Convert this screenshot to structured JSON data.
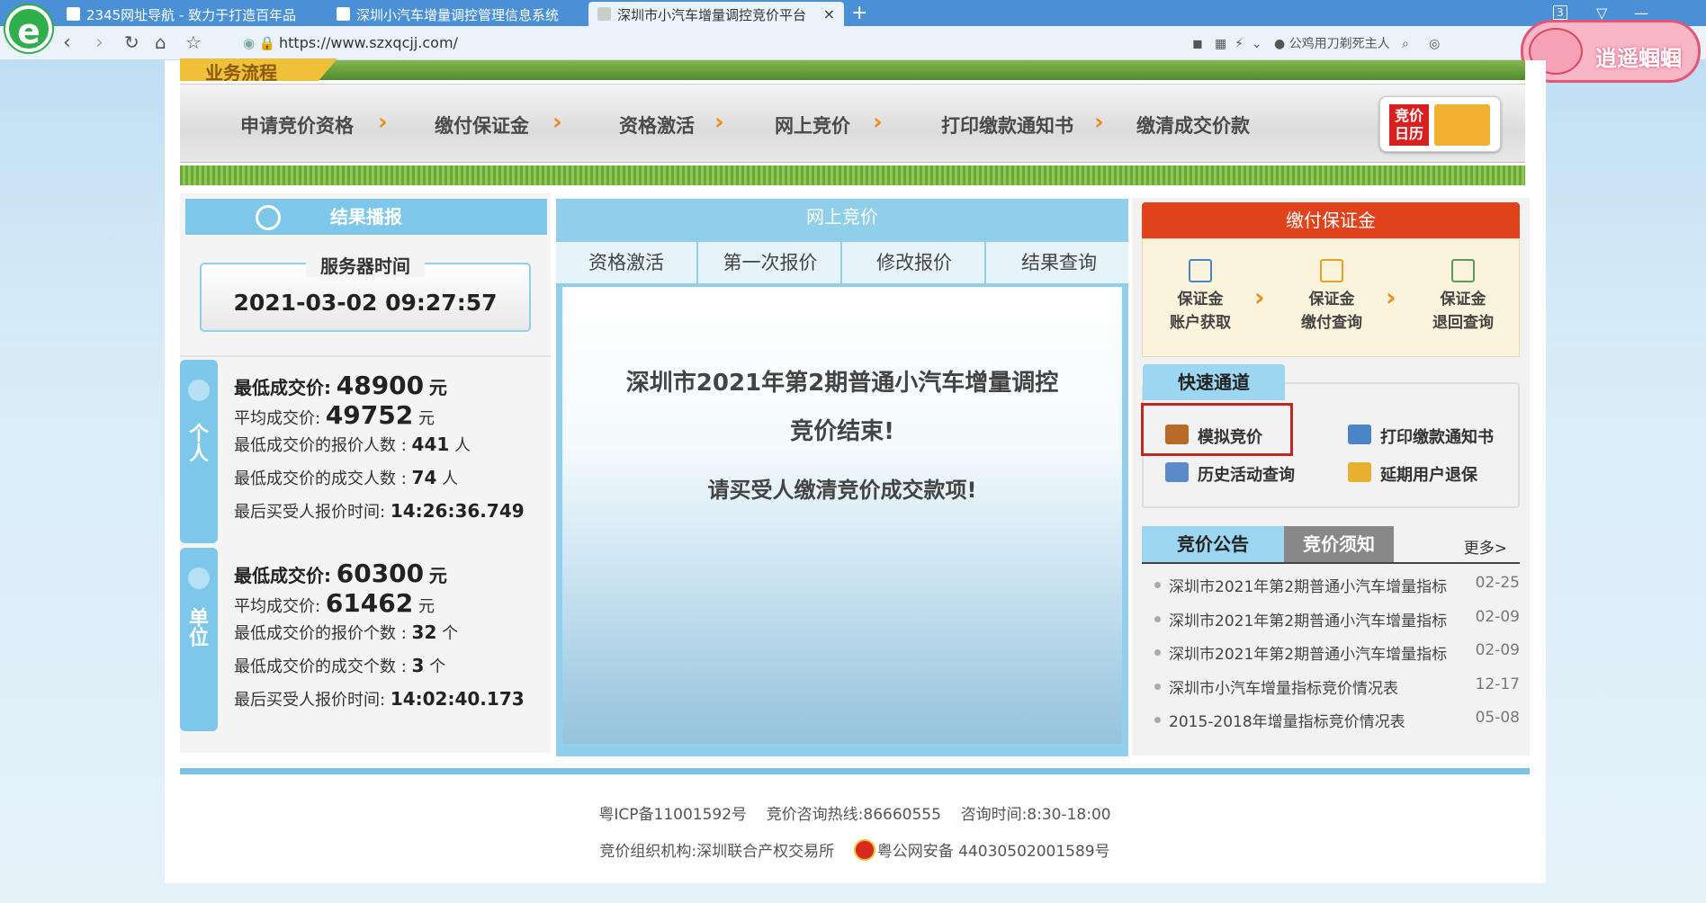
{
  "browser": {
    "tabs": [
      {
        "label": "2345网址导航 - 致力于打造百年品"
      },
      {
        "label": "深圳小汽车增量调控管理信息系统"
      },
      {
        "label": "深圳市小汽车增量调控竞价平台"
      }
    ],
    "url": "https://www.szxqcjj.com/",
    "tab_count": "3",
    "toolbar_text": "公鸡用刀剃死主人",
    "pig_label": "逍遥蝈蝈"
  },
  "process": {
    "tag": "业务流程",
    "steps": [
      "申请竞价资格",
      "缴付保证金",
      "资格激活",
      "网上竞价",
      "打印缴款通知书",
      "缴清成交价款"
    ],
    "calendar_label": "竞价日历"
  },
  "results": {
    "header": "结果播报",
    "server_time_label": "服务器时间",
    "server_time": "2021-03-02 09:27:57",
    "personal": {
      "label": "个人",
      "min_price_label": "最低成交价:",
      "min_price": "48900",
      "avg_price_label": "平均成交价:",
      "avg_price": "49752",
      "unit": "元",
      "min_bidders_label": "最低成交价的报价人数 :",
      "min_bidders": "441",
      "min_deals_label": "最低成交价的成交人数 :",
      "min_deals": "74",
      "count_unit": "人",
      "last_time_label": "最后买受人报价时间:",
      "last_time": "14:26:36.749"
    },
    "company": {
      "label": "单位",
      "min_price_label": "最低成交价:",
      "min_price": "60300",
      "avg_price_label": "平均成交价:",
      "avg_price": "61462",
      "unit": "元",
      "min_bidders_label": "最低成交价的报价个数 :",
      "min_bidders": "32",
      "min_deals_label": "最低成交价的成交个数 :",
      "min_deals": "3",
      "count_unit": "个",
      "last_time_label": "最后买受人报价时间:",
      "last_time": "14:02:40.173"
    }
  },
  "bidding": {
    "header": "网上竞价",
    "tabs": [
      "资格激活",
      "第一次报价",
      "修改报价",
      "结果查询"
    ],
    "msg_line1": "深圳市2021年第2期普通小汽车增量调控",
    "msg_line2": "竞价结束!",
    "msg_line3": "请买受人缴清竞价成交款项!"
  },
  "deposit": {
    "header": "缴付保证金",
    "items": [
      {
        "line1": "保证金",
        "line2": "账户获取"
      },
      {
        "line1": "保证金",
        "line2": "缴付查询"
      },
      {
        "line1": "保证金",
        "line2": "退回查询"
      }
    ]
  },
  "quick": {
    "header": "快速通道",
    "items": [
      "模拟竞价",
      "打印缴款通知书",
      "历史活动查询",
      "延期用户退保"
    ]
  },
  "notices": {
    "tab_active": "竞价公告",
    "tab_inactive": "竞价须知",
    "more": "更多>",
    "items": [
      {
        "title": "深圳市2021年第2期普通小汽车增量指标",
        "date": "02-25"
      },
      {
        "title": "深圳市2021年第2期普通小汽车增量指标",
        "date": "02-09"
      },
      {
        "title": "深圳市2021年第2期普通小汽车增量指标",
        "date": "02-09"
      },
      {
        "title": "深圳市小汽车增量指标竞价情况表",
        "date": "12-17"
      },
      {
        "title": "2015-2018年增量指标竞价情况表",
        "date": "05-08"
      }
    ]
  },
  "footer": {
    "icp": "粤ICP备11001592号",
    "hotline": "竞价咨询热线:86660555",
    "hours": "咨询时间:8:30-18:00",
    "org": "竞价组织机构:深圳联合产权交易所",
    "police": "粤公网安备 44030502001589号"
  }
}
